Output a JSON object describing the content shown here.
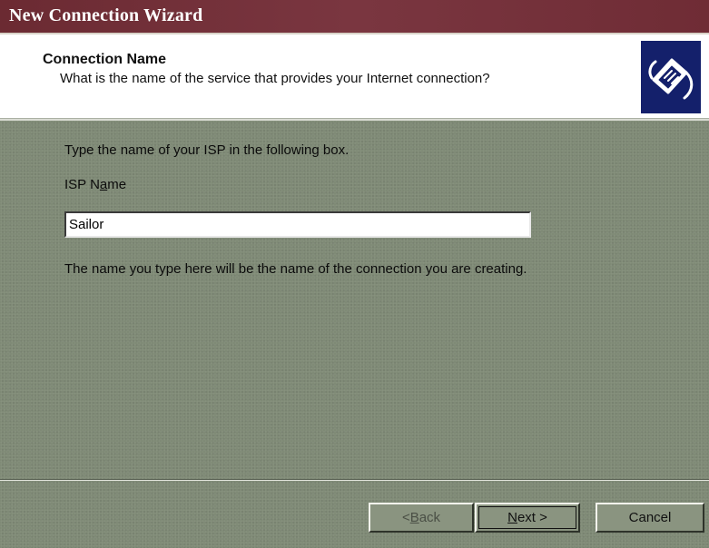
{
  "window": {
    "title": "New Connection Wizard"
  },
  "header": {
    "title": "Connection Name",
    "subtitle": "What is the name of the service that provides your Internet connection?",
    "logo_icon": "network-cable-icon"
  },
  "content": {
    "instruction": "Type the name of your ISP in the following box.",
    "field_label_prefix": "ISP N",
    "field_label_accel": "a",
    "field_label_suffix": "me",
    "isp_name_value": "Sailor",
    "note": "The name you type here will be the name of the connection you are creating."
  },
  "buttons": {
    "back_prefix": "< ",
    "back_accel": "B",
    "back_suffix": "ack",
    "next_accel": "N",
    "next_suffix": "ext >",
    "cancel": "Cancel"
  },
  "colors": {
    "titlebar": "#6b2a32",
    "dialog_bg": "#7f8a76",
    "logo_bg": "#14206b"
  }
}
